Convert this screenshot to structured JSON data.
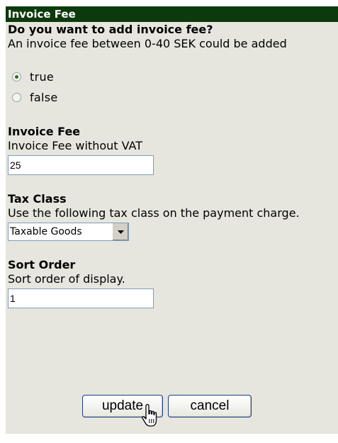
{
  "header": {
    "title": "Invoice Fee"
  },
  "invoice_fee_option": {
    "question": "Do you want to add invoice fee?",
    "description": "An invoice fee between 0-40 SEK could be added",
    "options": [
      {
        "label": "true",
        "checked": true
      },
      {
        "label": "false",
        "checked": false
      }
    ]
  },
  "invoice_fee": {
    "title": "Invoice Fee",
    "description": "Invoice Fee without VAT",
    "value": "25"
  },
  "tax_class": {
    "title": "Tax Class",
    "description": "Use the following tax class on the payment charge.",
    "selected": "Taxable Goods"
  },
  "sort_order": {
    "title": "Sort Order",
    "description": "Sort order of display.",
    "value": "1"
  },
  "buttons": {
    "update": "update",
    "cancel": "cancel"
  },
  "icons": {
    "cursor": "hand-pointer-icon",
    "select_arrow": "chevron-down-icon"
  },
  "colors": {
    "header_bg": "#0d3a0d",
    "panel_bg": "#e6e6de",
    "button_border": "#1e3c8e"
  }
}
